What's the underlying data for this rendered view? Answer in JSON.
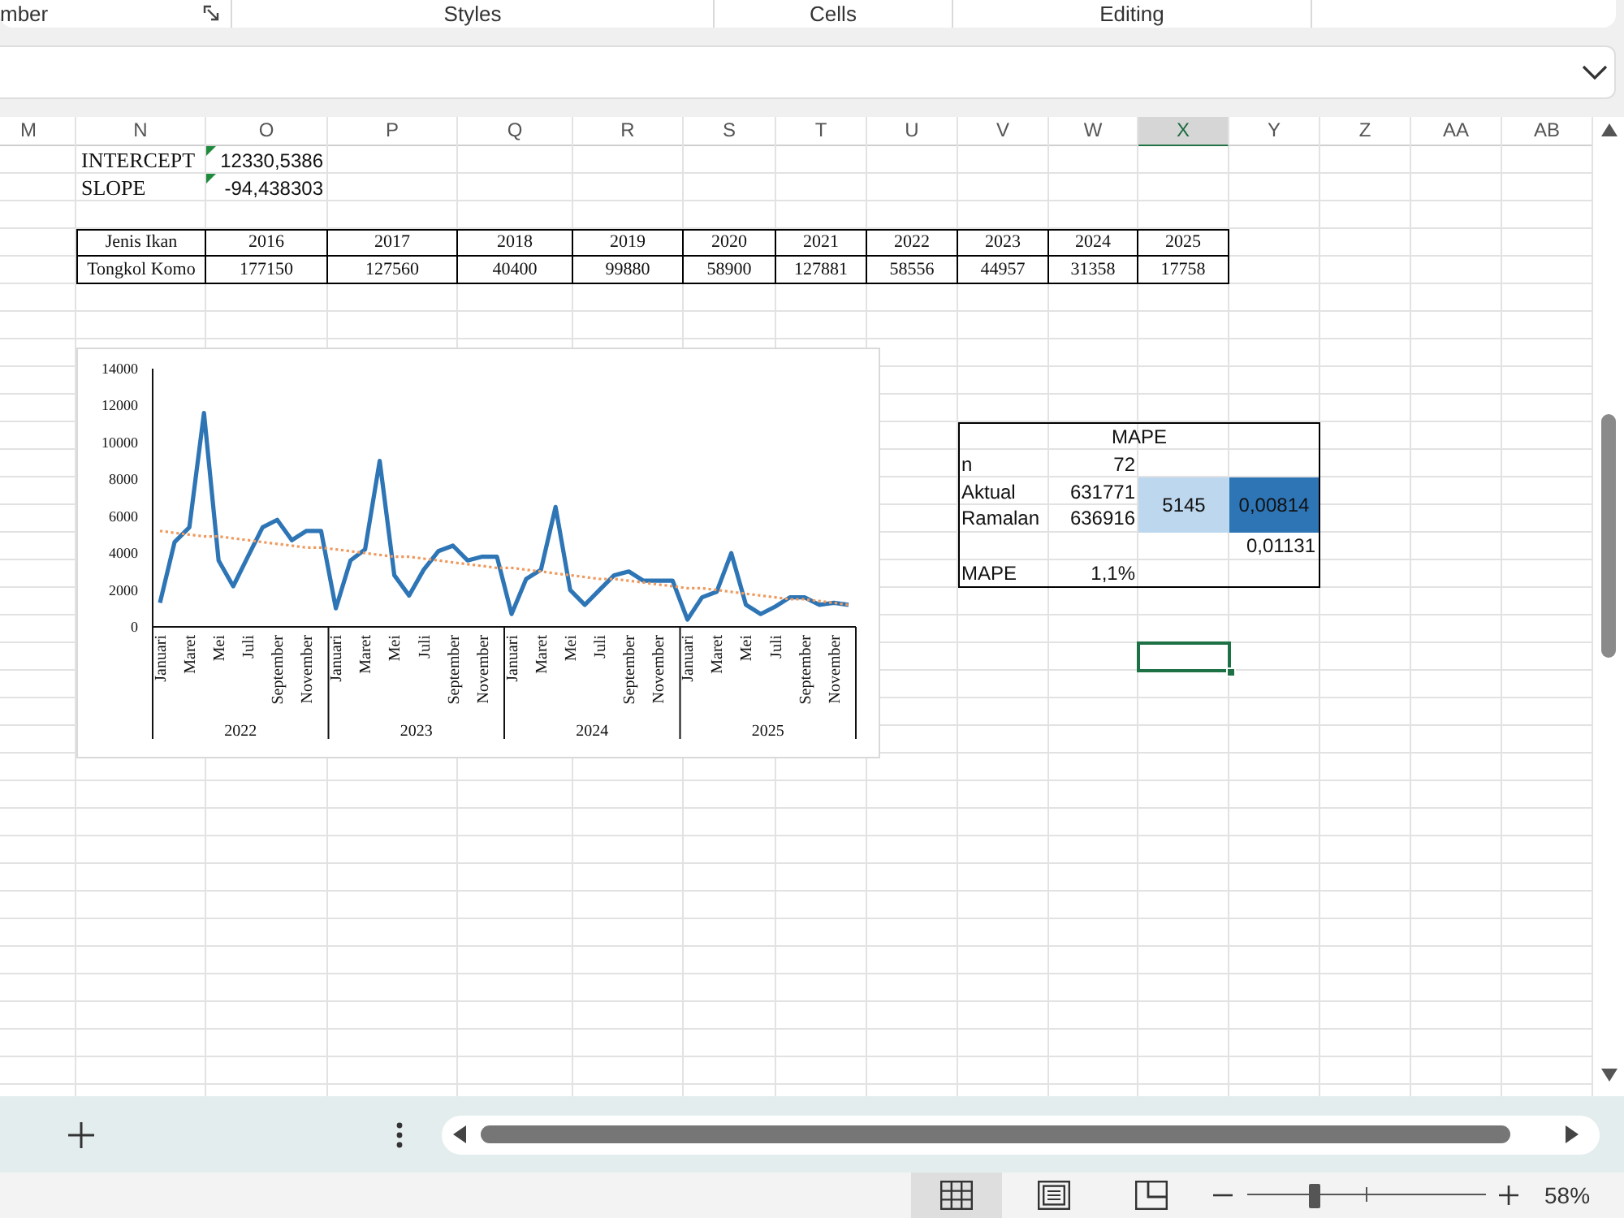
{
  "ribbon_groups": [
    {
      "label": "mber",
      "launcher": true
    },
    {
      "label": "Styles",
      "launcher": false
    },
    {
      "label": "Cells",
      "launcher": false
    },
    {
      "label": "Editing",
      "launcher": false
    }
  ],
  "columns": [
    {
      "label": "M",
      "selected": false
    },
    {
      "label": "N",
      "selected": false
    },
    {
      "label": "O",
      "selected": false
    },
    {
      "label": "P",
      "selected": false
    },
    {
      "label": "Q",
      "selected": false
    },
    {
      "label": "R",
      "selected": false
    },
    {
      "label": "S",
      "selected": false
    },
    {
      "label": "T",
      "selected": false
    },
    {
      "label": "U",
      "selected": false
    },
    {
      "label": "V",
      "selected": false
    },
    {
      "label": "W",
      "selected": false
    },
    {
      "label": "X",
      "selected": true
    },
    {
      "label": "Y",
      "selected": false
    },
    {
      "label": "Z",
      "selected": false
    },
    {
      "label": "AA",
      "selected": false
    },
    {
      "label": "AB",
      "selected": false
    }
  ],
  "stats": [
    {
      "label": "INTERCEPT",
      "value": "12330,5386",
      "flagged": true
    },
    {
      "label": "SLOPE",
      "value": "-94,438303",
      "flagged": true
    }
  ],
  "fish_table": {
    "columns": [
      "Jenis Ikan",
      "2016",
      "2017",
      "2018",
      "2019",
      "2020",
      "2021",
      "2022",
      "2023",
      "2024",
      "2025"
    ],
    "rows": [
      [
        "Tongkol Komo",
        "177150",
        "127560",
        "40400",
        "99880",
        "58900",
        "127881",
        "58556",
        "44957",
        "31358",
        "17758"
      ]
    ]
  },
  "chart": {
    "chart_data": {
      "type": "line",
      "ylim": [
        0,
        14000
      ],
      "yticks": [
        0,
        2000,
        4000,
        6000,
        8000,
        10000,
        12000,
        14000
      ],
      "categories": [
        "Januari",
        null,
        "Maret",
        null,
        "Mei",
        null,
        "Juli",
        null,
        "September",
        null,
        "November",
        null,
        "Januari",
        null,
        "Maret",
        null,
        "Mei",
        null,
        "Juli",
        null,
        "September",
        null,
        "November",
        null,
        "Januari",
        null,
        "Maret",
        null,
        "Mei",
        null,
        "Juli",
        null,
        "September",
        null,
        "November",
        null,
        "Januari",
        null,
        "Maret",
        null,
        "Mei",
        null,
        "Juli",
        null,
        "September",
        null,
        "November",
        null
      ],
      "annotations": [
        "2022",
        "2023",
        "2024",
        "2025"
      ],
      "series": [
        {
          "color": "#2e75b6",
          "values": [
            1300,
            4600,
            5400,
            11600,
            3600,
            2200,
            3800,
            5400,
            5800,
            4700,
            5200,
            5200,
            1000,
            3600,
            4200,
            9000,
            2800,
            1700,
            3100,
            4100,
            4400,
            3600,
            3800,
            3800,
            700,
            2600,
            3100,
            6500,
            2000,
            1200,
            2000,
            2800,
            3000,
            2500,
            2500,
            2500,
            400,
            1600,
            1900,
            4000,
            1200,
            700,
            1100,
            1600,
            1600,
            1200,
            1300,
            1200
          ]
        },
        {
          "color": "#ee9a5e",
          "line_style": "dotted",
          "values": [
            5200,
            5100,
            5000,
            4900,
            4900,
            4800,
            4700,
            4600,
            4500,
            4400,
            4300,
            4300,
            4200,
            4100,
            4000,
            3900,
            3800,
            3800,
            3700,
            3600,
            3500,
            3400,
            3300,
            3200,
            3200,
            3100,
            3000,
            2900,
            2800,
            2700,
            2600,
            2600,
            2500,
            2400,
            2300,
            2200,
            2100,
            2100,
            2000,
            1900,
            1800,
            1700,
            1600,
            1500,
            1500,
            1400,
            1300,
            1200
          ]
        }
      ]
    }
  },
  "mape_table": {
    "title": "MAPE",
    "rows": [
      {
        "label": "n",
        "value": "72"
      },
      {
        "label": "Aktual",
        "value": "631771"
      },
      {
        "label": "Ramalan",
        "value": "636916"
      },
      {
        "result": "0,01131"
      },
      {
        "label": "MAPE",
        "value": "1,1%"
      }
    ],
    "difference": "5145",
    "ratio": "0,00814"
  },
  "status_bar": {
    "views": [
      {
        "kind": "normal",
        "selected": true
      },
      {
        "kind": "page_layout",
        "selected": false
      },
      {
        "kind": "page_break",
        "selected": false
      }
    ],
    "zoom_slider": {
      "level": 0.28,
      "reading": "58%"
    }
  }
}
